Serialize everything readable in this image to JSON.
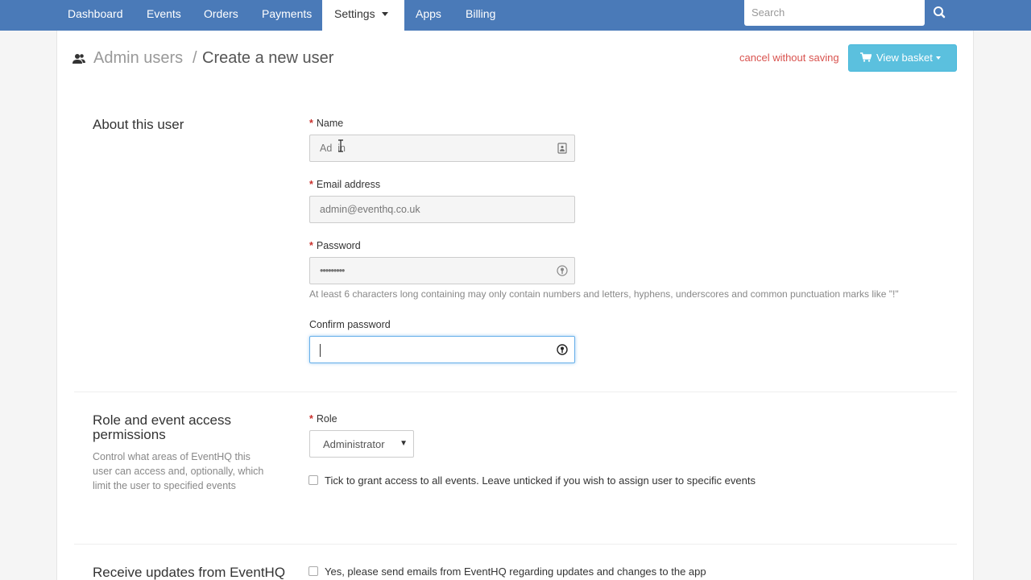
{
  "nav": {
    "items": [
      "Dashboard",
      "Events",
      "Orders",
      "Payments",
      "Settings",
      "Apps",
      "Billing"
    ],
    "active": "Settings",
    "search_placeholder": "Search"
  },
  "header": {
    "breadcrumb_parent": "Admin users",
    "separator": "/",
    "title": "Create a new user",
    "cancel_label": "cancel without saving",
    "basket_label": "View basket"
  },
  "about": {
    "section_title": "About this user",
    "name_label": "Name",
    "name_value": "Ad  in",
    "email_label": "Email address",
    "email_value": "admin@eventhq.co.uk",
    "password_label": "Password",
    "password_value": "•••••••••",
    "password_help": "At least 6 characters long containing may only contain numbers and letters, hyphens, underscores and common punctuation marks like \"!\"",
    "confirm_label": "Confirm password",
    "confirm_value": ""
  },
  "role": {
    "section_title_line1": "Role and event access",
    "section_title_line2": "permissions",
    "description": "Control what areas of EventHQ this user can access and, optionally, which limit the user to specified events",
    "role_label": "Role",
    "role_value": "Administrator",
    "all_events_label": "Tick to grant access to all events. Leave unticked if you wish to assign user to specific events",
    "all_events_checked": false
  },
  "updates": {
    "section_title": "Receive updates from EventHQ",
    "emails_label": "Yes, please send emails from EventHQ regarding updates and changes to the app",
    "emails_checked": false
  },
  "colors": {
    "nav_bg": "#4a7ab8",
    "cancel": "#d9534f",
    "basket": "#5bc0de",
    "required": "#c9302c"
  },
  "icons": [
    "users-icon",
    "search-icon",
    "cart-icon",
    "contact-card-icon",
    "key-icon",
    "chevron-down-icon"
  ]
}
